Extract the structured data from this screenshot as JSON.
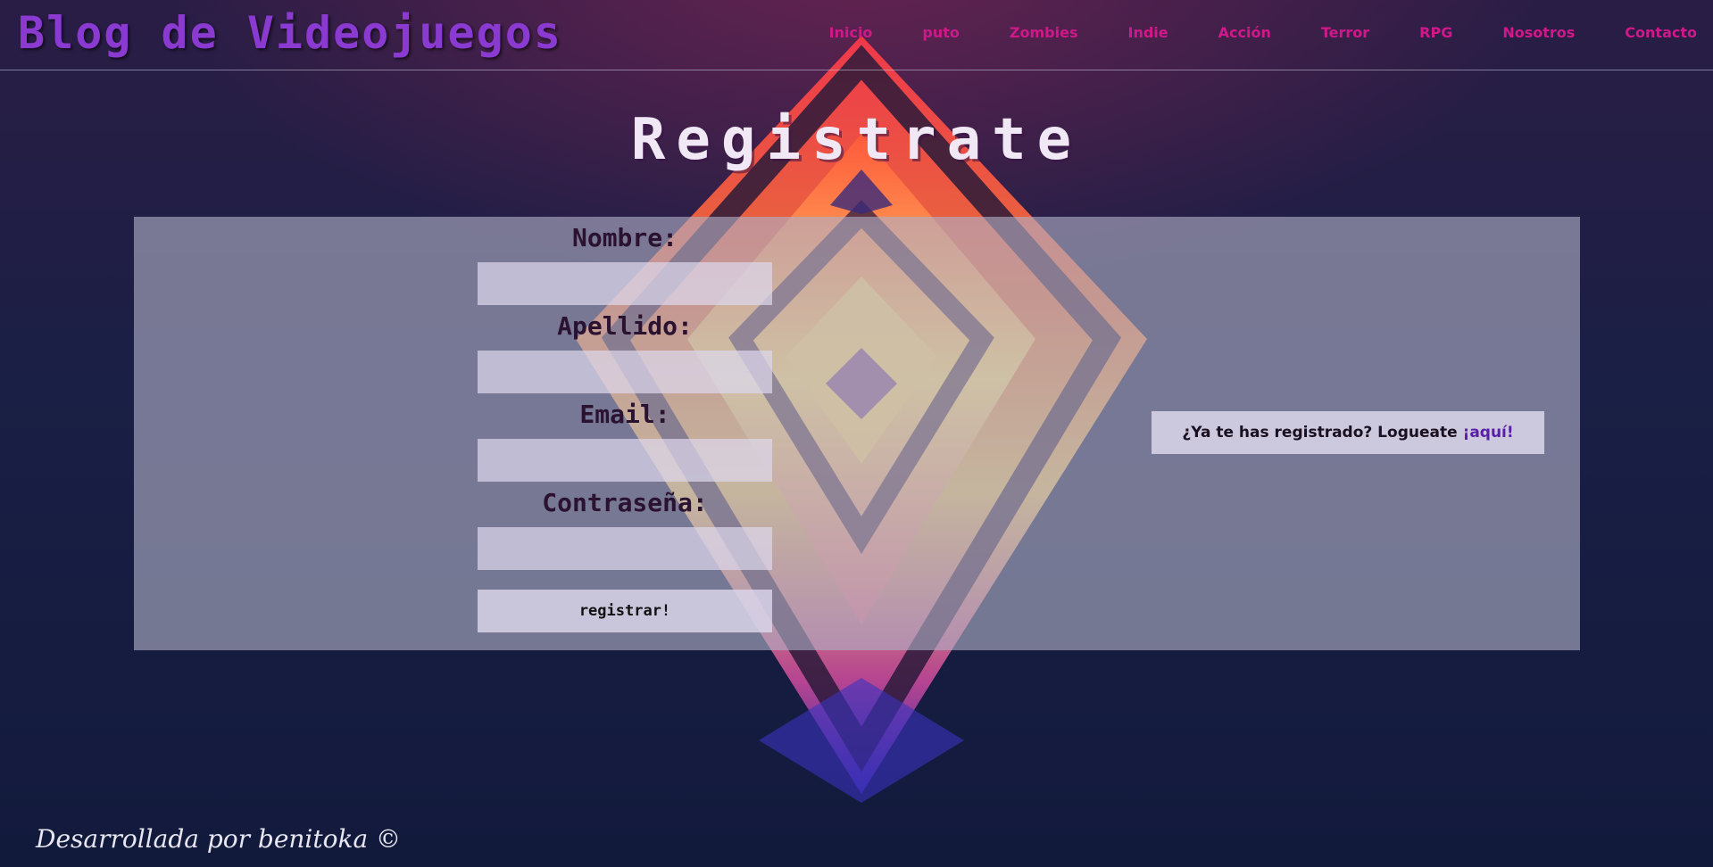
{
  "site": {
    "brand": "Blog de Videojuegos"
  },
  "nav": {
    "items": [
      "Inicio",
      "puto",
      "Zombies",
      "Indie",
      "Acción",
      "Terror",
      "RPG",
      "Nosotros",
      "Contacto"
    ]
  },
  "page": {
    "title": "Registrate"
  },
  "form": {
    "fields": [
      {
        "label": "Nombre:",
        "value": "",
        "placeholder": ""
      },
      {
        "label": "Apellido:",
        "value": "",
        "placeholder": ""
      },
      {
        "label": "Email:",
        "value": "",
        "placeholder": ""
      },
      {
        "label": "Contraseña:",
        "value": "",
        "placeholder": ""
      }
    ],
    "submit_label": "registrar!"
  },
  "login_prompt": {
    "text": "¿Ya te has registrado? Logueate ",
    "link_text": "¡aquí!"
  },
  "footer": {
    "text": "Desarrollada por benitoka ©"
  },
  "colors": {
    "background": "#131b3d",
    "brand": "#8a3ad1",
    "nav_link": "#d0188a",
    "title": "#f0e8f4",
    "panel": "#b0b0c6",
    "link": "#5a1fa8"
  },
  "icons": {
    "background_art": "abstract-diamond-art"
  }
}
